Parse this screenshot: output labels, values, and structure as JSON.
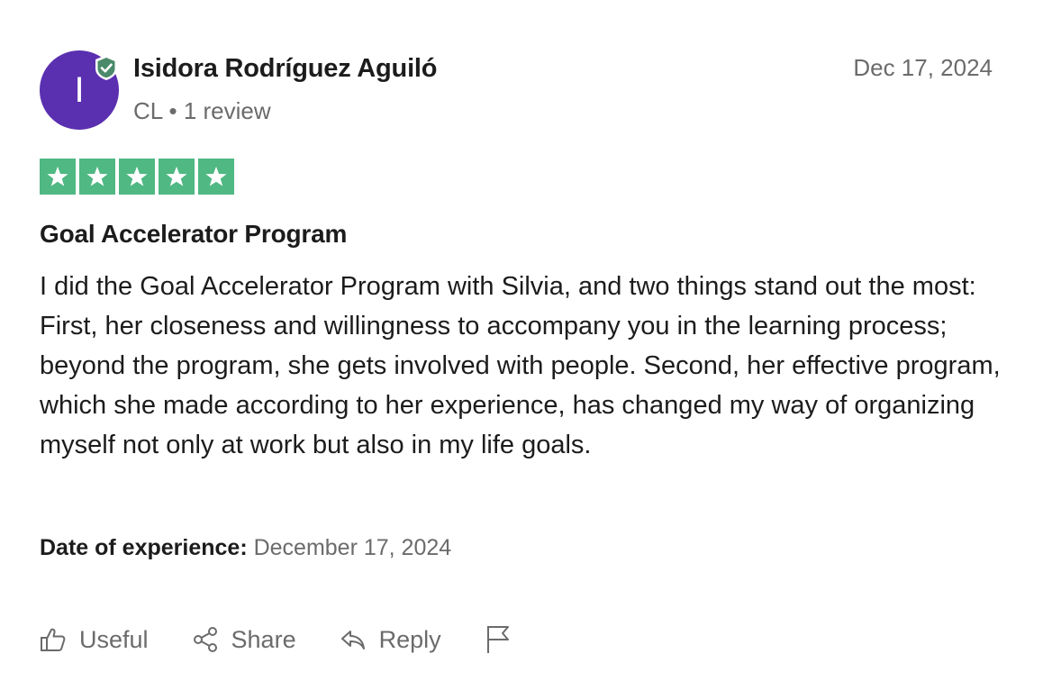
{
  "reviewer": {
    "initial": "I",
    "name": "Isidora Rodríguez Aguiló",
    "country": "CL",
    "review_count": "1 review",
    "meta": "CL • 1 review",
    "avatar_color": "#5a2fb0"
  },
  "review": {
    "date": "Dec 17, 2024",
    "rating": 5,
    "max_rating": 5,
    "star_color": "#4fb883",
    "title": "Goal Accelerator Program",
    "body": "I did the Goal Accelerator Program with Silvia, and two things stand out the most: First, her closeness and willingness to accompany you in the learning process; beyond the program, she gets involved with people. Second, her effective program, which she made according to her experience, has changed my way of organizing myself not only at work but also in my life goals.",
    "experience_label": "Date of experience:",
    "experience_date": "December 17, 2024"
  },
  "actions": {
    "useful_label": "Useful",
    "share_label": "Share",
    "reply_label": "Reply",
    "icons": [
      "thumbs-up-icon",
      "share-icon",
      "reply-icon",
      "flag-icon"
    ]
  }
}
